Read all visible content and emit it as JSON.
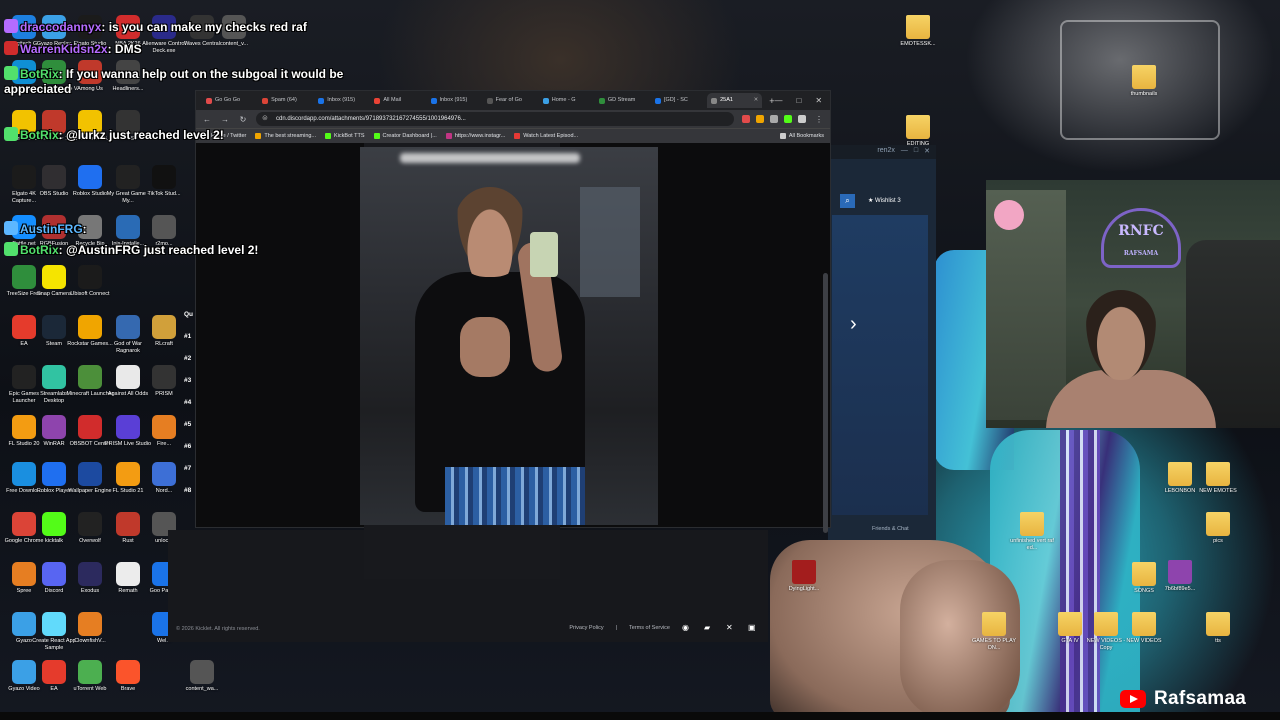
{
  "chat": [
    {
      "user": "draccodannyx",
      "message": ": is you can make my checks red raf"
    },
    {
      "user": "WarrenKidsn2x",
      "message": ": DMS"
    },
    {
      "user": "BotRix",
      "message": ": If you wanna help out on the subgoal it would be"
    },
    {
      "user": "",
      "message": "appreciated"
    },
    {
      "user": "BotRix",
      "message": ": @lurkz just reached level 2!"
    },
    {
      "user": "AustinFRG",
      "message": ":"
    },
    {
      "user": "BotRix",
      "message": ": @AustinFRG just reached level 2!"
    }
  ],
  "desktop_icons_left": [
    {
      "label": "Logitech G",
      "color": "#1d7fe0"
    },
    {
      "label": "Gyazo Replay",
      "color": "#3ba0e6"
    },
    {
      "label": "Elgato Studio",
      "color": "#1b1b1b"
    },
    {
      "label": "NBA 2K26",
      "color": "#d12c2c"
    },
    {
      "label": "Alienware Control Deck.exe",
      "color": "#2a2a8a"
    },
    {
      "label": "Waves Central",
      "color": "#333"
    },
    {
      "label": "content_v...",
      "color": "#555"
    },
    {
      "label": "Edge",
      "color": "#0f8fd4"
    },
    {
      "label": "Grand Theft Auto V",
      "color": "#2f8e3c"
    },
    {
      "label": "Among Us",
      "color": "#c0392b"
    },
    {
      "label": "Headliners...",
      "color": "#444"
    },
    {
      "label": "Norton 360",
      "color": "#f2c200"
    },
    {
      "label": "CCleaner 7",
      "color": "#c0392b"
    },
    {
      "label": "Norton Installati...",
      "color": "#f2c200"
    },
    {
      "label": "RPCS3",
      "color": "#333"
    },
    {
      "label": "Elgato 4K Capture...",
      "color": "#1b1b1b"
    },
    {
      "label": "OBS Studio",
      "color": "#302e31"
    },
    {
      "label": "Roblox Studio",
      "color": "#1f6ff0"
    },
    {
      "label": "My Great Game - My...",
      "color": "#222"
    },
    {
      "label": "TikTok Stud...",
      "color": "#111"
    },
    {
      "label": "Battle.net",
      "color": "#148eff"
    },
    {
      "label": "RGBFusion",
      "color": "#b03030"
    },
    {
      "label": "Recycle Bin",
      "color": "#777"
    },
    {
      "label": "Inis-Installe...",
      "color": "#2a6bb5"
    },
    {
      "label": "r2mo...",
      "color": "#555"
    },
    {
      "label": "TreeSize Free",
      "color": "#2f8e3c"
    },
    {
      "label": "Snap Camera",
      "color": "#f5e400"
    },
    {
      "label": "Ubisoft Connect",
      "color": "#1b1b1b"
    },
    {
      "label": "EA",
      "color": "#e53b2c"
    },
    {
      "label": "Steam",
      "color": "#1b2838"
    },
    {
      "label": "Rockstar Games...",
      "color": "#f0a500"
    },
    {
      "label": "God of War Ragnarok",
      "color": "#3569b0"
    },
    {
      "label": "RLcraft",
      "color": "#d1a03a"
    },
    {
      "label": "Epic Games Launcher",
      "color": "#222"
    },
    {
      "label": "Streamlabs Desktop",
      "color": "#31c3a2"
    },
    {
      "label": "Minecraft Launcher",
      "color": "#4c8f3a"
    },
    {
      "label": "Against All Odds",
      "color": "#e9e9e9"
    },
    {
      "label": "PRISM",
      "color": "#333"
    },
    {
      "label": "FL Studio 20",
      "color": "#f39c12"
    },
    {
      "label": "WinRAR",
      "color": "#8e44ad"
    },
    {
      "label": "OBSBOT Center",
      "color": "#d12c2c"
    },
    {
      "label": "PRISM Live Studio",
      "color": "#5a3fd6"
    },
    {
      "label": "Fire...",
      "color": "#e67e22"
    },
    {
      "label": "Free Downlo...",
      "color": "#1a8fe0"
    },
    {
      "label": "Roblox Player",
      "color": "#1f6ff0"
    },
    {
      "label": "Wallpaper Engine",
      "color": "#1c4aa0"
    },
    {
      "label": "FL Studio 21",
      "color": "#f39c12"
    },
    {
      "label": "Nord...",
      "color": "#3d6fd6"
    },
    {
      "label": "Google Chrome",
      "color": "#db4437"
    },
    {
      "label": "kicktalk",
      "color": "#53fc18"
    },
    {
      "label": "Overwolf",
      "color": "#222"
    },
    {
      "label": "Rust",
      "color": "#c0392b"
    },
    {
      "label": "unloc...",
      "color": "#555"
    },
    {
      "label": "Spree",
      "color": "#e67e22"
    },
    {
      "label": "Discord",
      "color": "#5865f2"
    },
    {
      "label": "Exodus",
      "color": "#2c2a5e"
    },
    {
      "label": "Remath",
      "color": "#ececec"
    },
    {
      "label": "Goo Pass...",
      "color": "#1a73e8"
    },
    {
      "label": "Gyazo",
      "color": "#3ba0e6"
    },
    {
      "label": "Create React App Sample",
      "color": "#61dafb"
    },
    {
      "label": "ClownfishV...",
      "color": "#e67e22"
    },
    {
      "label": "Wel...",
      "color": "#1a73e8"
    },
    {
      "label": "Gyazo Video",
      "color": "#3ba0e6"
    },
    {
      "label": "EA",
      "color": "#e53b2c"
    },
    {
      "label": "uTorrent Web",
      "color": "#4caf50"
    },
    {
      "label": "Brave",
      "color": "#fb542b"
    },
    {
      "label": "content_wa...",
      "color": "#555"
    }
  ],
  "desktop_icons_right": [
    {
      "label": "EMOTESSK...",
      "color": "#f6d365"
    },
    {
      "label": "thumbnails",
      "color": "#f6d365"
    },
    {
      "label": "EDITING",
      "color": "#f6d365"
    },
    {
      "label": "LEBONBON",
      "color": "#f6d365"
    },
    {
      "label": "NEW EMOTES",
      "color": "#f6d365"
    },
    {
      "label": "unfinished vert raf ed...",
      "color": "#f6d365"
    },
    {
      "label": "pics",
      "color": "#f6d365"
    },
    {
      "label": "DyingLight...",
      "color": "#a31d1d"
    },
    {
      "label": "SONGS",
      "color": "#f6d365"
    },
    {
      "label": "7b6bf89e5...",
      "color": "#8e44ad"
    },
    {
      "label": "GAMES TO PLAY ON...",
      "color": "#f6d365"
    },
    {
      "label": "GTA IV",
      "color": "#f6d365"
    },
    {
      "label": "NEW VIDEOS - Copy",
      "color": "#f6d365"
    },
    {
      "label": "NEW VIDEOS",
      "color": "#f6d365"
    },
    {
      "label": "tts",
      "color": "#f6d365"
    }
  ],
  "browser": {
    "tabs": [
      "Go Go Go",
      "Spam (64)",
      "Inbox (915)",
      "All Mail",
      "Inbox (915)",
      "Fear of Go",
      "Home - G",
      "GD Stream",
      "[GD] - SC",
      "25A1"
    ],
    "url": "cdn.discordapp.com/attachments/971893732167274555/1001964976...",
    "bookmarks": [
      "Home / Twitter",
      "The best streaming...",
      "KickBot TTS",
      "Creator Dashboard |...",
      "https://www.instagr...",
      "Watch Latest Episod..."
    ],
    "all_bookmarks": "All Bookmarks",
    "left_nav": [
      "Qu",
      "#1",
      "#2",
      "#3",
      "#4",
      "#5",
      "#6",
      "#7",
      "#8"
    ]
  },
  "kicklet": {
    "copyright": "© 2026 Kicklet. All rights reserved.",
    "privacy": "Privacy Policy",
    "terms": "Terms of Service",
    "separator": "|"
  },
  "steam": {
    "wishlist": "Wishlist 3",
    "friends": "Friends & Chat",
    "minimize": "—",
    "maximize": "□",
    "close": "✕",
    "user_fragment": "ren2x"
  },
  "webcam": {
    "sign": "RNFC",
    "sign_sub": "RAFSAMA"
  },
  "brand": {
    "channel": "Rafsamaa"
  },
  "colors": {
    "chat_user": "#b56cff",
    "chat_bot": "#52e06c",
    "youtube_red": "#ff0000",
    "steam_bg": "#1b2838"
  }
}
